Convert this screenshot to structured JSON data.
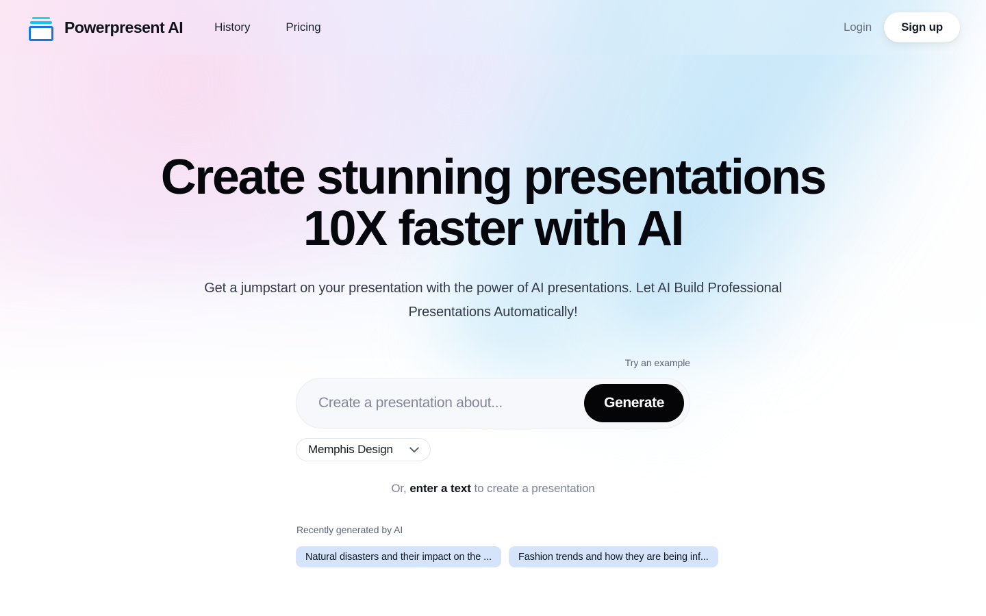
{
  "header": {
    "logo_icon": "presentation-board-icon",
    "brand_name": "Powerpresent AI",
    "nav": [
      {
        "label": "History"
      },
      {
        "label": "Pricing"
      }
    ],
    "login_label": "Login",
    "signup_label": "Sign up",
    "colors": {
      "logo_bar_top": "#1ad7ef",
      "logo_bar_mid": "#12c8e8",
      "logo_body_border": "#1677e3"
    }
  },
  "hero": {
    "title_line1": "Create stunning presentations",
    "title_line2": "10X faster with AI",
    "subtitle": "Get a jumpstart on your presentation with the power of AI presentations. Let AI Build Professional Presentations Automatically!"
  },
  "prompt": {
    "try_example_label": "Try an example",
    "input_placeholder": "Create a presentation about...",
    "input_value": "",
    "generate_label": "Generate",
    "style_selected": "Memphis Design",
    "chevron_icon": "chevron-down-icon",
    "or_prefix": "Or, ",
    "or_link": "enter a text",
    "or_suffix": " to create a presentation"
  },
  "recent": {
    "title": "Recently generated by AI",
    "chips": [
      {
        "label": "Natural disasters and their impact on the ..."
      },
      {
        "label": "Fashion trends and how they are being inf..."
      }
    ],
    "chip_bg": "#d5e4fb"
  }
}
